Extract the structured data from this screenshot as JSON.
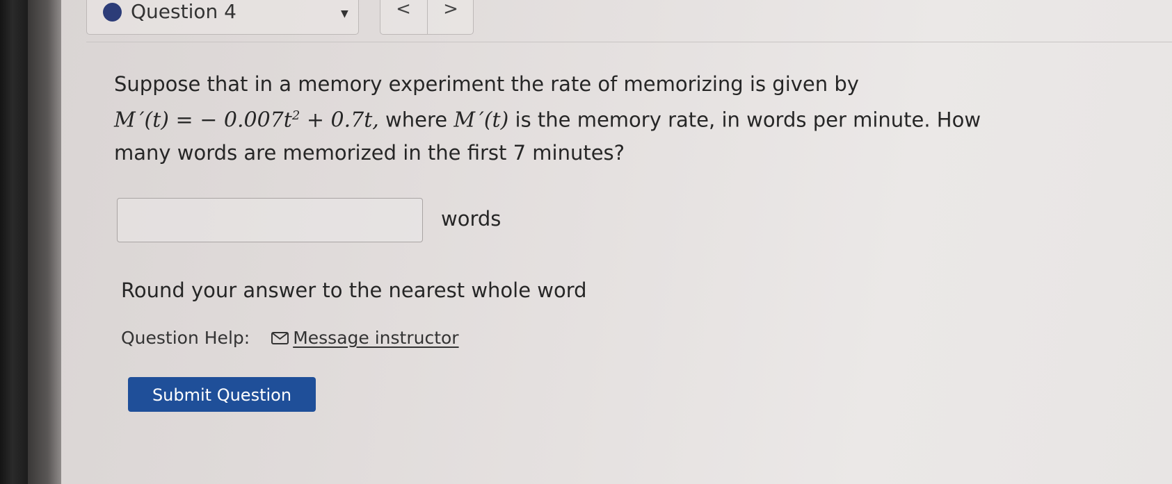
{
  "header": {
    "question_label": "Question 4",
    "prev_label": "<",
    "next_label": ">"
  },
  "question": {
    "line1": "Suppose that in a memory experiment the rate of memorizing is given by",
    "expr_lhs": "M ′(t)",
    "expr_eq": " = ",
    "expr_rhs_a": "− 0.007t",
    "expr_exp": "2",
    "expr_rhs_b": " + 0.7t,",
    "mid_text": " where ",
    "expr_ref": "M ′(t)",
    "tail_text": " is the memory rate, in words per minute. How",
    "line3": "many words are memorized in the first 7 minutes?"
  },
  "answer": {
    "value": "",
    "placeholder": "",
    "unit": "words"
  },
  "instruction": "Round your answer to the nearest whole word",
  "help": {
    "label": "Question Help:",
    "link_label": "Message instructor"
  },
  "submit_label": "Submit Question",
  "colors": {
    "accent": "#1f4f99",
    "dot": "#2c3c78"
  }
}
